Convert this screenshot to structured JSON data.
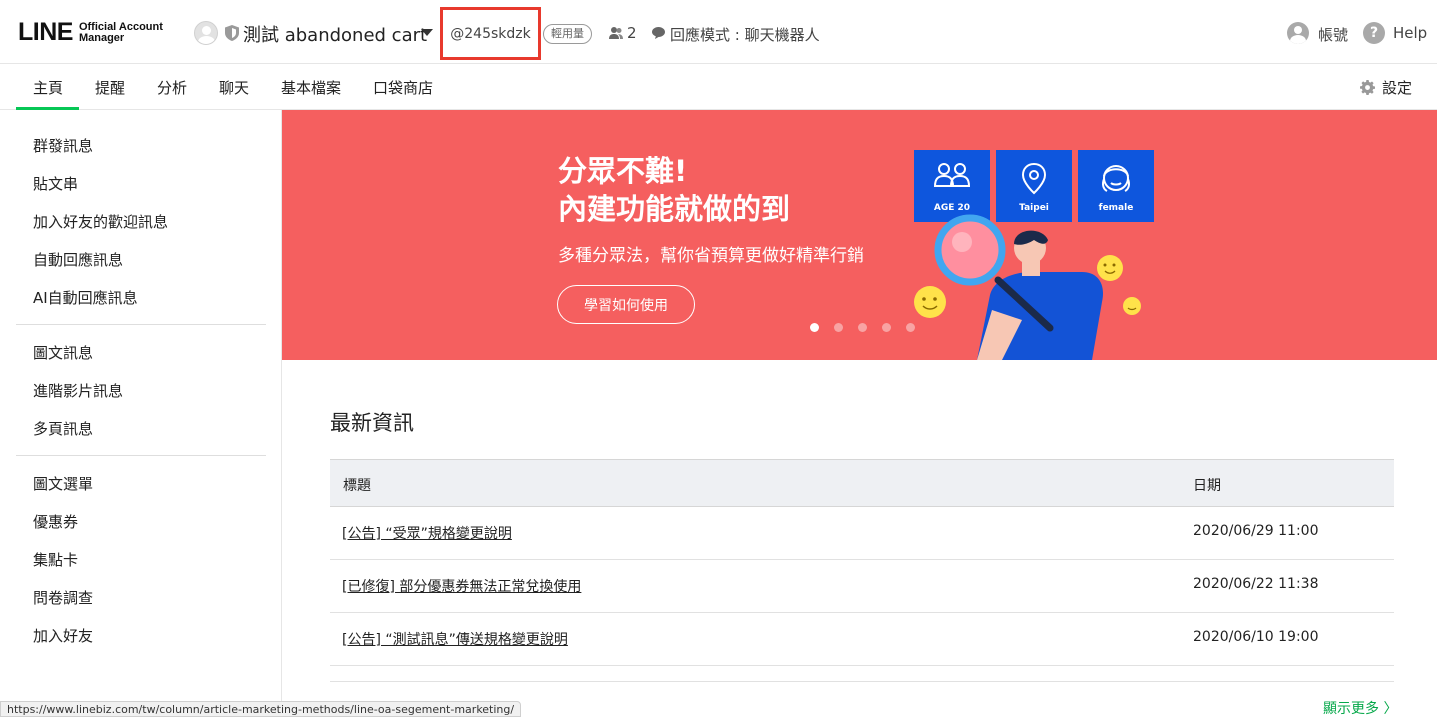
{
  "header": {
    "logo_main": "LINE",
    "logo_sub_1": "Official Account",
    "logo_sub_2": "Manager",
    "account_name": "測試 abandoned cart",
    "account_id": "@245skdzk",
    "plan_badge": "輕用量",
    "friends_count": "2",
    "reply_mode": "回應模式 : 聊天機器人",
    "account_label": "帳號",
    "help_label": "Help"
  },
  "nav": {
    "tabs": [
      "主頁",
      "提醒",
      "分析",
      "聊天",
      "基本檔案",
      "口袋商店"
    ],
    "active_tab": "主頁",
    "settings_label": "設定"
  },
  "sidebar": {
    "group1": [
      "群發訊息",
      "貼文串",
      "加入好友的歡迎訊息",
      "自動回應訊息",
      "AI自動回應訊息"
    ],
    "group2": [
      "圖文訊息",
      "進階影片訊息",
      "多頁訊息"
    ],
    "group3": [
      "圖文選單",
      "優惠券",
      "集點卡",
      "問卷調查",
      "加入好友"
    ]
  },
  "banner": {
    "headline_1": "分眾不難!",
    "headline_2": "內建功能就做的到",
    "subtitle": "多種分眾法，幫你省預算更做好精準行銷",
    "button_label": "學習如何使用",
    "tiles": [
      "AGE 20",
      "Taipei",
      "female"
    ],
    "active_slide": 1,
    "slide_count": 5,
    "bg_color": "#f55f5f",
    "tile_color": "#0e56dd"
  },
  "news": {
    "title": "最新資訊",
    "col_title": "標題",
    "col_date": "日期",
    "rows": [
      {
        "title": "[公告] “受眾”規格變更說明",
        "date": "2020/06/29 11:00"
      },
      {
        "title": "[已修復] 部分優惠券無法正常兌換使用",
        "date": "2020/06/22 11:38"
      },
      {
        "title": "[公告] “測試訊息”傳送規格變更說明",
        "date": "2020/06/10 19:00"
      }
    ],
    "more_label": "顯示更多 〉"
  },
  "status_url": "https://www.linebiz.com/tw/column/article-marketing-methods/line-oa-segement-marketing/",
  "colors": {
    "accent": "#06c755",
    "highlight_box": "#e8392d",
    "link_green": "#06a84a"
  }
}
